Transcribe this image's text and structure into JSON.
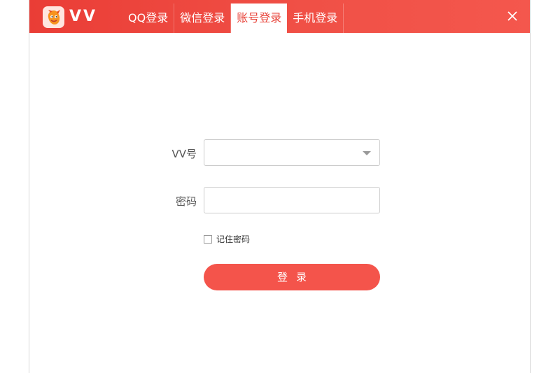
{
  "app": {
    "name": "VV",
    "logo_icon": "cartoon-mascot-logo-icon"
  },
  "tabs": [
    {
      "label": "QQ登录",
      "active": false
    },
    {
      "label": "微信登录",
      "active": false
    },
    {
      "label": "账号登录",
      "active": true
    },
    {
      "label": "手机登录",
      "active": false
    }
  ],
  "window": {
    "close_icon": "close-icon"
  },
  "form": {
    "account_label": "VV号",
    "account_value": "",
    "password_label": "密码",
    "password_value": "",
    "remember_label": "记住密码",
    "remember_checked": false,
    "login_label": "登录"
  },
  "colors": {
    "accent": "#f4544b",
    "titlebar": "#ec4239",
    "tab_active_text": "#e8453b"
  }
}
